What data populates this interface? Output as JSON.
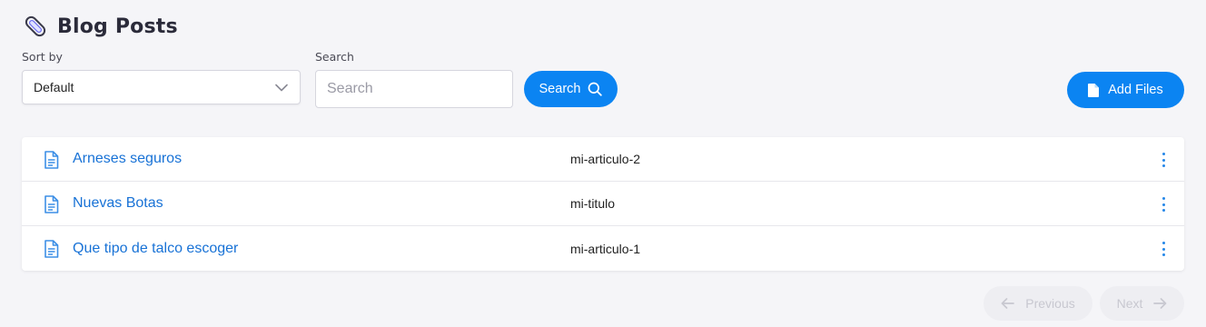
{
  "header": {
    "title": "Blog Posts",
    "icon": "paperclip-icon"
  },
  "sort": {
    "label": "Sort by",
    "selected": "Default"
  },
  "search": {
    "label": "Search",
    "placeholder": "Search",
    "value": "",
    "button_label": "Search"
  },
  "toolbar": {
    "add_files_label": "Add Files"
  },
  "posts": [
    {
      "title": "Arneses seguros",
      "slug": "mi-articulo-2"
    },
    {
      "title": "Nuevas Botas",
      "slug": "mi-titulo"
    },
    {
      "title": "Que tipo de talco escoger",
      "slug": "mi-articulo-1"
    }
  ],
  "pagination": {
    "previous_label": "Previous",
    "next_label": "Next"
  },
  "colors": {
    "accent": "#0b84f2",
    "link": "#1872d6",
    "background": "#f5f5f8"
  }
}
